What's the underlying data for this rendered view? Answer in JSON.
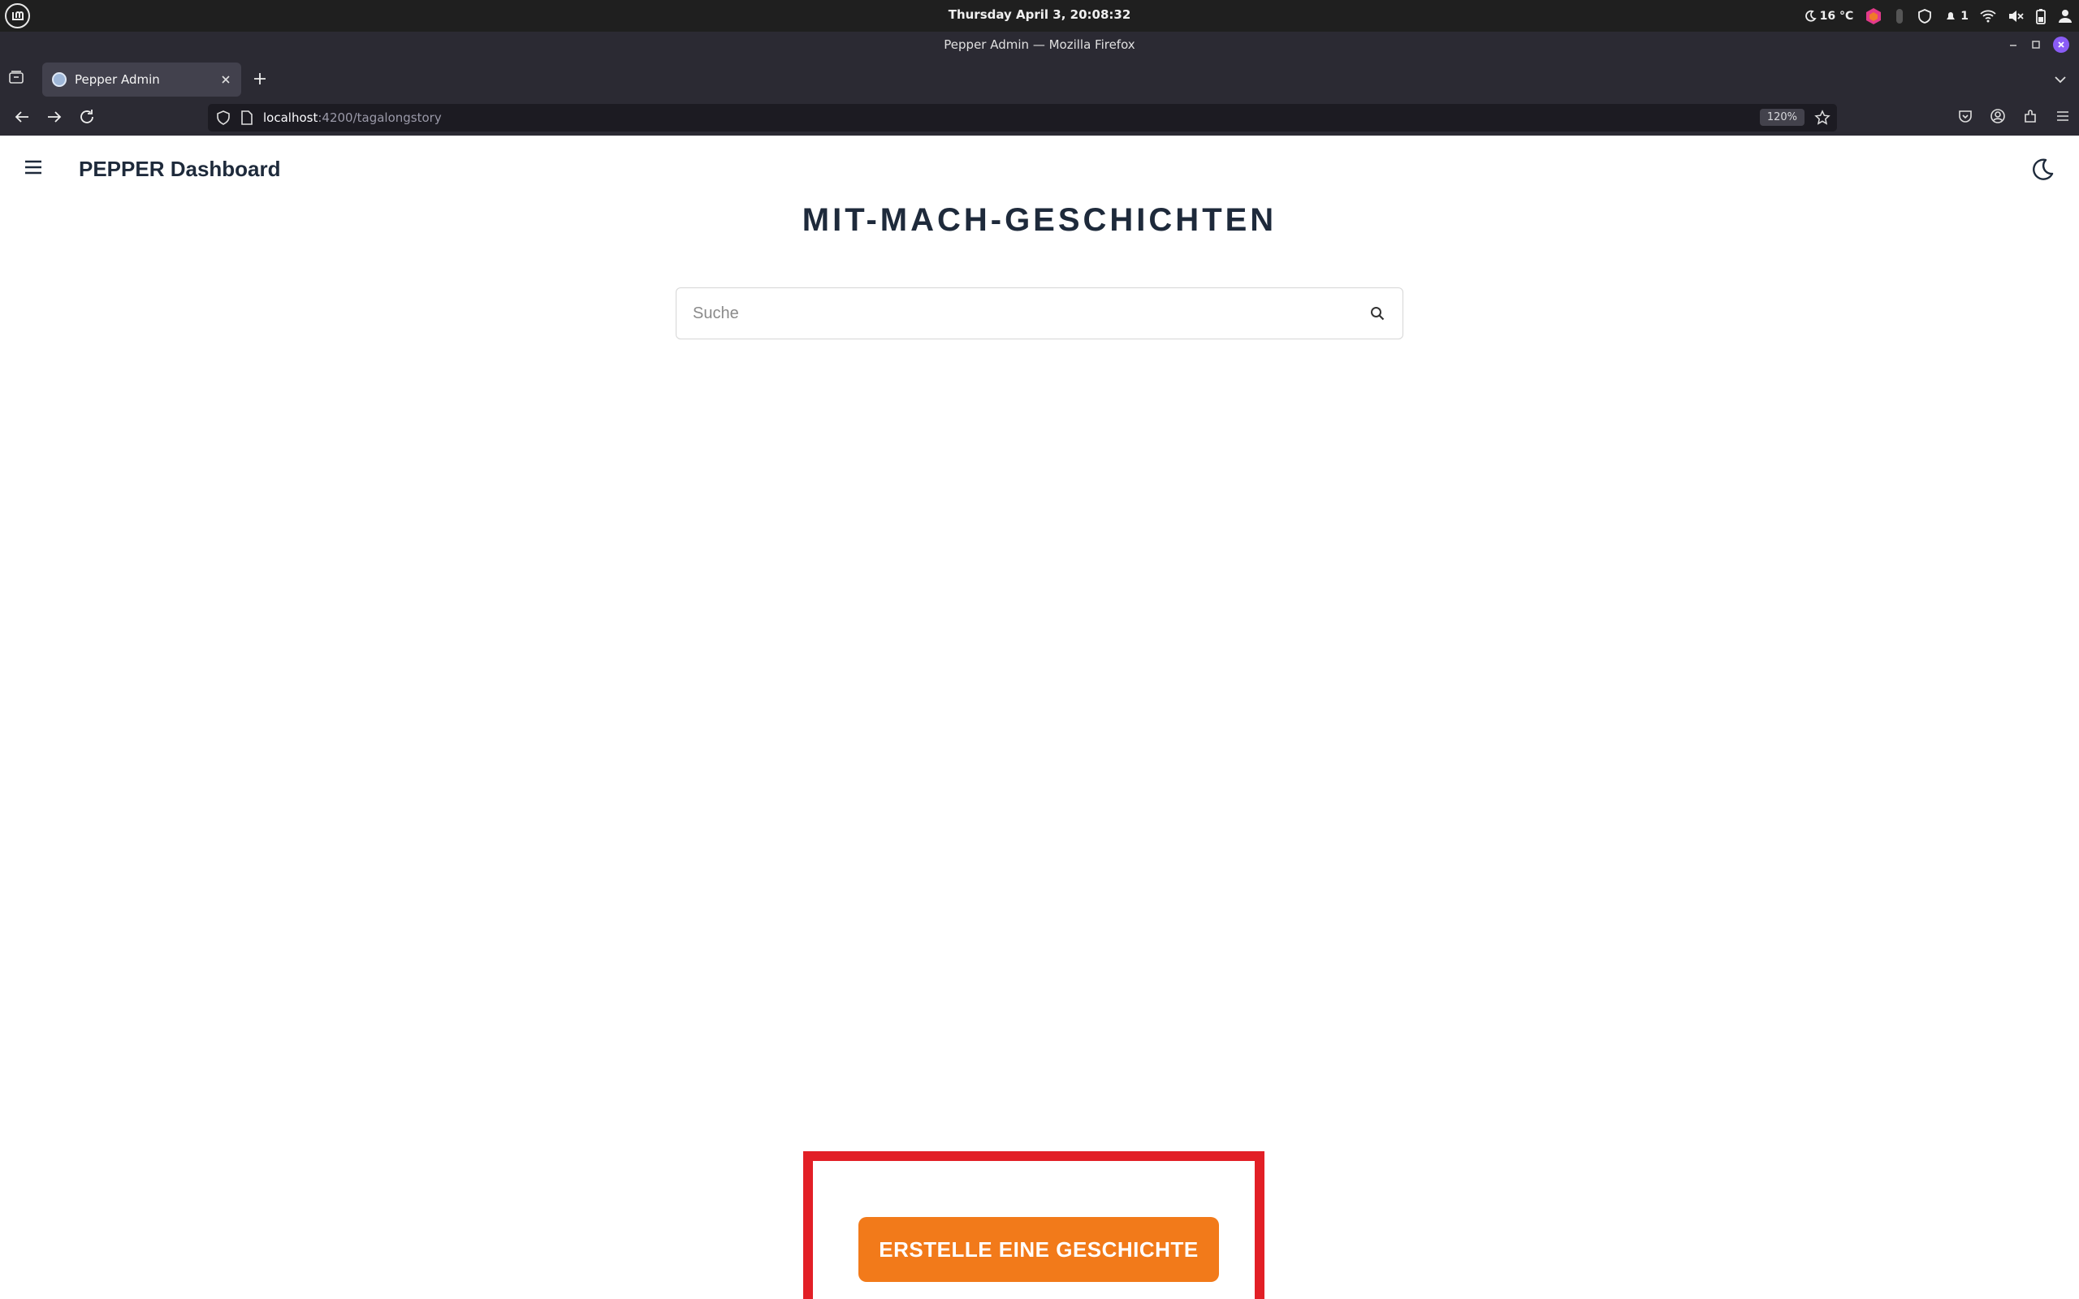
{
  "os": {
    "clock": "Thursday April 3, 20:08:32",
    "weather": "16 °C",
    "notifications_count": "1"
  },
  "browser": {
    "window_title": "Pepper Admin — Mozilla Firefox",
    "tab_title": "Pepper Admin",
    "url_host": "localhost",
    "url_path": ":4200/tagalongstory",
    "zoom": "120%"
  },
  "app": {
    "brand": "PEPPER Dashboard",
    "heading": "MIT-MACH-GESCHICHTEN",
    "search_placeholder": "Suche",
    "create_button": "ERSTELLE EINE GESCHICHTE"
  },
  "colors": {
    "accent": "#f27a1a",
    "highlight": "#e21f26",
    "text_dark": "#1e2a3b"
  }
}
